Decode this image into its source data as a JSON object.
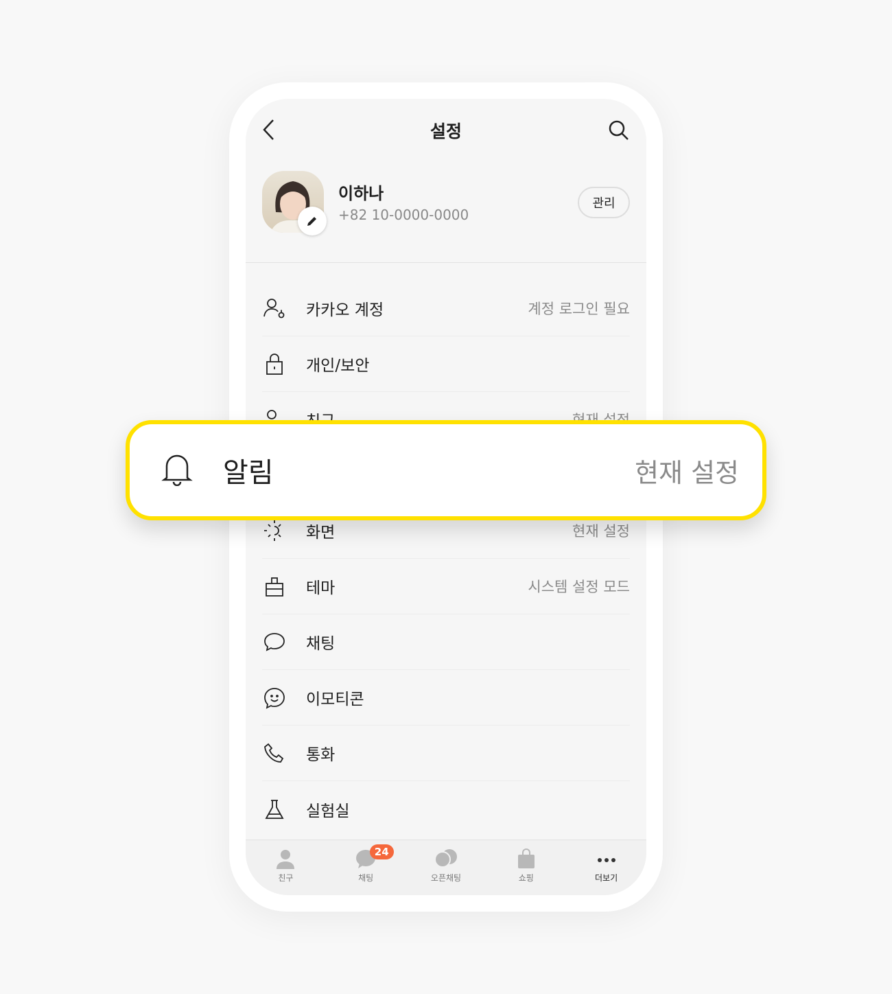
{
  "header": {
    "title": "설정"
  },
  "profile": {
    "name": "이하나",
    "phone": "+82 10-0000-0000",
    "manage_label": "관리"
  },
  "rows": [
    {
      "label": "카카오 계정",
      "value": "계정 로그인 필요",
      "icon": "account-icon"
    },
    {
      "label": "개인/보안",
      "value": "",
      "icon": "lock-icon"
    },
    {
      "label": "친구",
      "value": "현재 설정",
      "icon": "friend-icon"
    },
    {
      "label": "알림",
      "value": "",
      "icon": "bell-icon"
    },
    {
      "label": "화면",
      "value": "현재 설정",
      "icon": "sun-icon"
    },
    {
      "label": "테마",
      "value": "시스템 설정 모드",
      "icon": "theme-icon"
    },
    {
      "label": "채팅",
      "value": "",
      "icon": "chat-icon"
    },
    {
      "label": "이모티콘",
      "value": "",
      "icon": "emoticon-icon"
    },
    {
      "label": "통화",
      "value": "",
      "icon": "phone-icon"
    },
    {
      "label": "실험실",
      "value": "",
      "icon": "flask-icon"
    }
  ],
  "highlight": {
    "label": "알림",
    "value": "현재 설정",
    "border_color": "#FFE100"
  },
  "tabbar": [
    {
      "label": "친구",
      "icon": "person-icon"
    },
    {
      "label": "채팅",
      "icon": "chat-bubble-icon",
      "badge": "24"
    },
    {
      "label": "오픈채팅",
      "icon": "open-chat-icon"
    },
    {
      "label": "쇼핑",
      "icon": "shopping-bag-icon"
    },
    {
      "label": "더보기",
      "icon": "more-icon",
      "active": true
    }
  ],
  "colors": {
    "badge": "#F5683C",
    "highlight": "#FFE100"
  }
}
